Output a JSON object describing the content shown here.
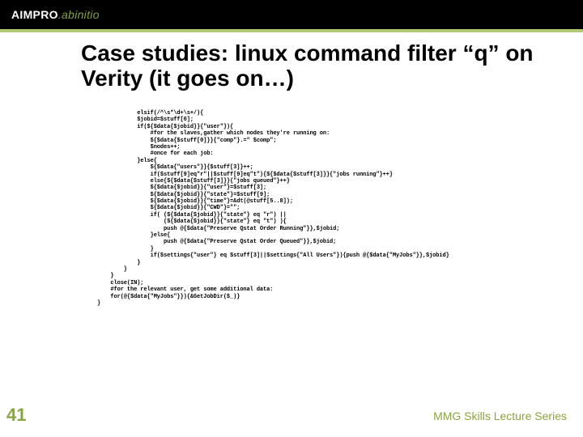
{
  "logo": {
    "part1": "AIMPRO",
    "dot": ".",
    "part2": "abinitio"
  },
  "title": "Case studies: linux command filter “q” on Verity (it goes on…)",
  "code": "            elsif(/^\\s*\\d+\\s+/){\n            $jobid=$stuff[0];\n            if(${$data{$jobid}}{\"user\"}){\n                #for the slaves,gather which nodes they're running on:\n                ${$data{$stuff[0]}}{\"comp\"}.=\" $comp\";\n                $nodes++;\n                #once for each job:\n            }else{\n                ${$data{\"users\"}}{$stuff[3]}++;\n                if($stuff[9]eq\"r\"||$stuff[9]eq\"t\"){${$data{$stuff[3]}}{\"jobs running\"}++}\n                else{${$data{$stuff[3]}}{\"jobs queued\"}++}\n                ${$data{$jobid}}{\"user\"}=$stuff[3];\n                ${$data{$jobid}}{\"state\"}=$stuff[9];\n                ${$data{$jobid}}{\"time\"}=&dt(@stuff[5..8]);\n                ${$data{$jobid}}{\"CWD\"}=\"\";\n                if( (${$data{$jobid}}{\"state\"} eq \"r\") ||\n                    (${$data{$jobid}}{\"state\"} eq \"t\") ){\n                    push @{$data{\"Preserve Qstat Order Running\"}},$jobid;\n                }else{\n                    push @{$data{\"Preserve Qstat Order Queued\"}},$jobid;\n                }\n                if($settings{\"user\"} eq $stuff[3]||$settings{\"All Users\"}){push @{$data{\"MyJobs\"}},$jobid}\n            }\n        }\n    }\n    close(IN);\n    #for the relevant user, get some additional data:\n    for(@{$data{\"MyJobs\"}}){&GetJobDir($_)}\n}",
  "slide_number": "41",
  "footer": "MMG Skills Lecture Series"
}
